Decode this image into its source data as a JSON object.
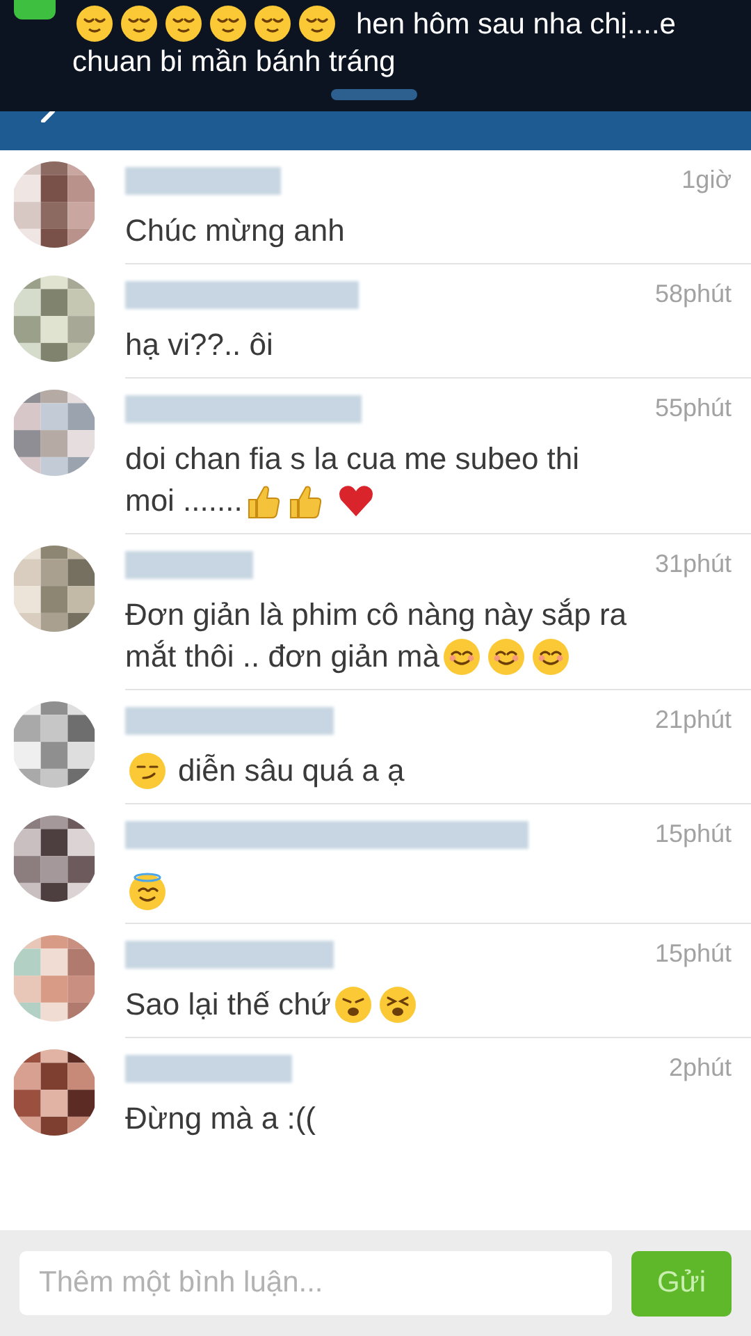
{
  "notification": {
    "parts": [
      {
        "kind": "relieved"
      },
      {
        "kind": "relieved"
      },
      {
        "kind": "relieved"
      },
      {
        "kind": "relieved"
      },
      {
        "kind": "relieved"
      },
      {
        "kind": "relieved"
      },
      {
        "kind": "text",
        "text": "hen hôm sau nha chị....e"
      },
      {
        "kind": "text",
        "text": "chuan bi mần bánh tráng"
      }
    ]
  },
  "comments": [
    {
      "time": "1giờ",
      "parts": [
        {
          "kind": "text",
          "text": "Chúc mừng anh"
        }
      ]
    },
    {
      "time": "58phút",
      "parts": [
        {
          "kind": "text",
          "text": "hạ vi??.. ôi"
        }
      ]
    },
    {
      "time": "55phút",
      "parts": [
        {
          "kind": "text",
          "text": "doi chan fia s la cua me subeo thi"
        },
        {
          "kind": "text",
          "text": "moi ......."
        },
        {
          "kind": "thumbsup"
        },
        {
          "kind": "thumbsup"
        },
        {
          "kind": "heart"
        }
      ]
    },
    {
      "time": "31phút",
      "parts": [
        {
          "kind": "text",
          "text": "Đơn giản là phim cô nàng này sắp ra"
        },
        {
          "kind": "text",
          "text": "mắt thôi .. đơn giản mà"
        },
        {
          "kind": "smiling"
        },
        {
          "kind": "smiling"
        },
        {
          "kind": "smiling"
        }
      ]
    },
    {
      "time": "21phút",
      "parts": [
        {
          "kind": "smirk"
        },
        {
          "kind": "text",
          "text": "diễn sâu quá a ạ"
        }
      ]
    },
    {
      "time": "15phút",
      "parts": [
        {
          "kind": "halo"
        }
      ]
    },
    {
      "time": "15phút",
      "parts": [
        {
          "kind": "text",
          "text": "Sao lại thế chứ"
        },
        {
          "kind": "weary"
        },
        {
          "kind": "tired"
        }
      ]
    },
    {
      "time": "2phút",
      "parts": [
        {
          "kind": "text",
          "text": "Đừng mà a :(("
        }
      ]
    }
  ],
  "composer": {
    "placeholder": "Thêm một bình luận...",
    "send": "Gửi"
  }
}
